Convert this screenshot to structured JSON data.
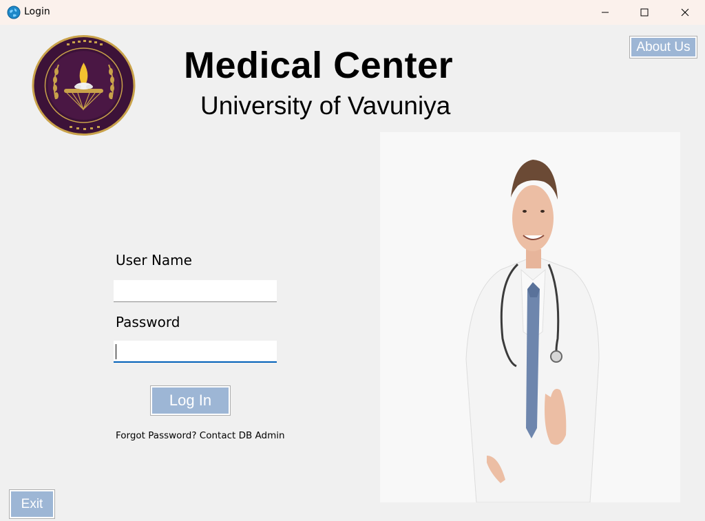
{
  "window": {
    "title": "Login",
    "app_icon": "globe-icon",
    "controls": [
      "minimize-icon",
      "maximize-icon",
      "close-icon"
    ]
  },
  "header": {
    "title": "Medical Center",
    "subtitle": "University of Vavuniya"
  },
  "about_button": {
    "label": "About Us"
  },
  "form": {
    "username_label": "User Name",
    "username_value": "",
    "password_label": "Password",
    "password_value": "",
    "login_label": "Log In",
    "forgot_text": "Forgot Password? Contact DB Admin"
  },
  "exit_button": {
    "label": "Exit"
  },
  "colors": {
    "button_bg": "#9db6d5",
    "focus_underline": "#005fb8",
    "logo_purple": "#3c1238",
    "logo_gold": "#c9a24a"
  }
}
